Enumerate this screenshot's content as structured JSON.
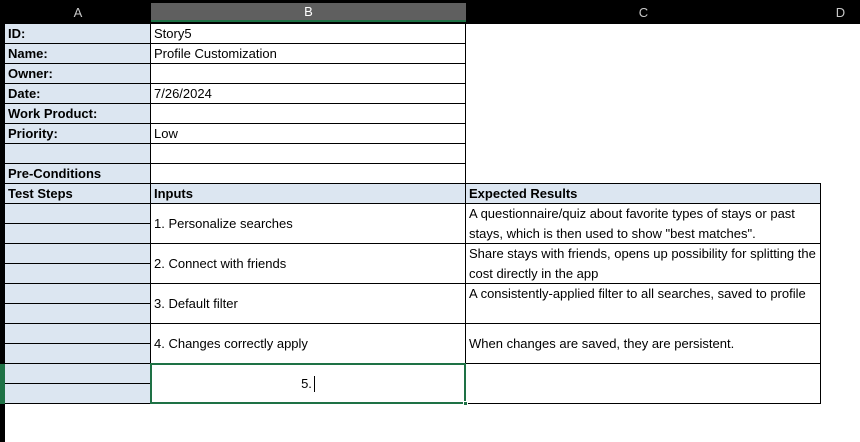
{
  "columns": [
    "A",
    "B",
    "C",
    "D"
  ],
  "info_rows": [
    {
      "label": "ID:",
      "value": "Story5"
    },
    {
      "label": "Name:",
      "value": "Profile Customization"
    },
    {
      "label": "Owner:",
      "value": ""
    },
    {
      "label": "Date:",
      "value": "7/26/2024"
    },
    {
      "label": "Work Product:",
      "value": ""
    },
    {
      "label": "Priority:",
      "value": "Low"
    }
  ],
  "preconditions_label": "Pre-Conditions",
  "table_headers": {
    "steps": "Test Steps",
    "inputs": "Inputs",
    "results": "Expected Results"
  },
  "steps": [
    {
      "input": "1. Personalize searches",
      "result": "A questionnaire/quiz about favorite types of stays or past stays, which is then used to show \"best matches\"."
    },
    {
      "input": "2. Connect with friends",
      "result": "Share stays with friends, opens up possibility for splitting the cost directly in the app"
    },
    {
      "input": "3. Default filter",
      "result": "A consistently-applied filter to all searches, saved to profile"
    },
    {
      "input": "4. Changes correctly apply",
      "result": "When changes are saved, they are persistent."
    }
  ],
  "active_cell": {
    "address": "B",
    "value": "5."
  }
}
